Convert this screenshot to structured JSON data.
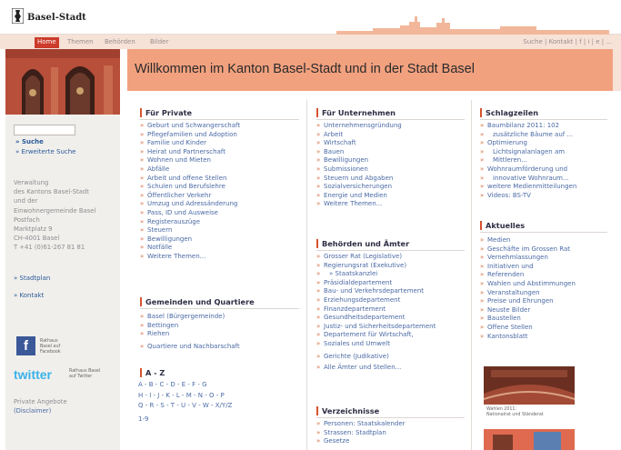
{
  "site": {
    "name": "Basel-Stadt"
  },
  "nav": {
    "tabs": [
      "Home",
      "Themen",
      "Behörden",
      "Bilder"
    ],
    "utility": "Suche  |  Kontakt  |  f  |  i  |  e  |  ..."
  },
  "banner": {
    "title": "Willkommen im Kanton Basel-Stadt und in der Stadt Basel"
  },
  "sidebar": {
    "search_value": "",
    "search_link": "Suche",
    "advanced_search": "Erweiterte Suche",
    "address": [
      "Verwaltung",
      "des Kantons Basel-Stadt",
      "und der",
      "Einwohnergemeinde Basel",
      "Postfach",
      "Marktplatz 9",
      "CH-4001 Basel",
      "T +41 (0)61-267 81 81"
    ],
    "links": [
      "Stadtplan",
      "Kontakt"
    ],
    "facebook_caption": [
      "Rathaus",
      "Basel auf",
      "Facebook"
    ],
    "twitter_word": "twitter",
    "twitter_caption": [
      "Rathaus Basel",
      "auf Twitter"
    ],
    "privacy": [
      "Private Angebote",
      "(Disclaimer)"
    ]
  },
  "col1": {
    "private": {
      "heading": "Für Private",
      "items": [
        "Geburt und Schwangerschaft",
        "Pflegefamilien und Adoption",
        "Familie und Kinder",
        "Heirat und Partnerschaft",
        "Wohnen und Mieten",
        "Abfälle",
        "Arbeit und offene Stellen",
        "Schulen und Berufslehre",
        "Öffentlicher Verkehr",
        "Umzug und Adressänderung",
        "Pass, ID und Ausweise",
        "Registerauszüge",
        "Steuern",
        "Bewilligungen",
        "Notfälle",
        "Weitere Themen..."
      ]
    },
    "gemeinden": {
      "heading": "Gemeinden und Quartiere",
      "items": [
        "Basel (Bürgergemeinde)",
        "Bettingen",
        "Riehen",
        "Quartiere und Nachbarschaft"
      ]
    },
    "az": {
      "heading": "A - Z",
      "rows": [
        "A - B - C - D - E - F - G",
        "H - I - J - K - L - M - N - O - P",
        "Q - R - S - T - U - V - W - X/Y/Z",
        "1-9"
      ]
    }
  },
  "col2": {
    "unternehmen": {
      "heading": "Für Unternehmen",
      "items": [
        "Unternehmensgründung",
        "Arbeit",
        "Wirtschaft",
        "Bauen",
        "Bewilligungen",
        "Submissionen",
        "Steuern und Abgaben",
        "Sozialversicherungen",
        "Energie und Medien",
        "Weitere Themen..."
      ]
    },
    "behoerden": {
      "heading": "Behörden und Ämter",
      "items": [
        "Grosser Rat (Legislative)",
        "Regierungsrat (Exekutive)",
        "» Staatskanzlei",
        "Präsidialdepartement",
        "Bau- und Verkehrsdepartement",
        "Erziehungsdepartement",
        "Finanzdepartement",
        "Gesundheitsdepartement",
        "Justiz- und Sicherheitsdepartement",
        "Departement für Wirtschaft,",
        "Soziales und Umwelt",
        "Gerichte (Judikative)",
        "Alle Ämter und Stellen..."
      ]
    },
    "verzeichnisse": {
      "heading": "Verzeichnisse",
      "items": [
        "Personen: Staatskalender",
        "Strassen: Stadtplan",
        "Gesetze"
      ]
    }
  },
  "col3": {
    "schlagzeilen": {
      "heading": "Schlagzeilen",
      "items": [
        "Baumbilanz 2011: 102",
        "zusätzliche Bäume auf ...",
        "Optimierung",
        "Lichtsignalanlagen am",
        "Mittleren...",
        "Wohnraumförderung und",
        "innovative Wohnraum...",
        "weitere Medienmitteilungen",
        "Videos: BS-TV"
      ]
    },
    "aktuelles": {
      "heading": "Aktuelles",
      "items": [
        "Medien",
        "Geschäfte im Grossen Rat",
        "Vernehmlassungen",
        "Initiativen und",
        "Referenden",
        "Wahlen und Abstimmungen",
        "Veranstaltungen",
        "Preise und Ehrungen",
        "Neuste Bilder",
        "Baustellen",
        "Offene Stellen",
        "Kantonsblatt"
      ]
    },
    "image_caption": [
      "Wahlen 2011:",
      "Nationalrat und Ständerat"
    ]
  },
  "colors": {
    "accent": "#cc3b2b",
    "banner": "#f2a17f",
    "link": "#4a6aa5"
  }
}
